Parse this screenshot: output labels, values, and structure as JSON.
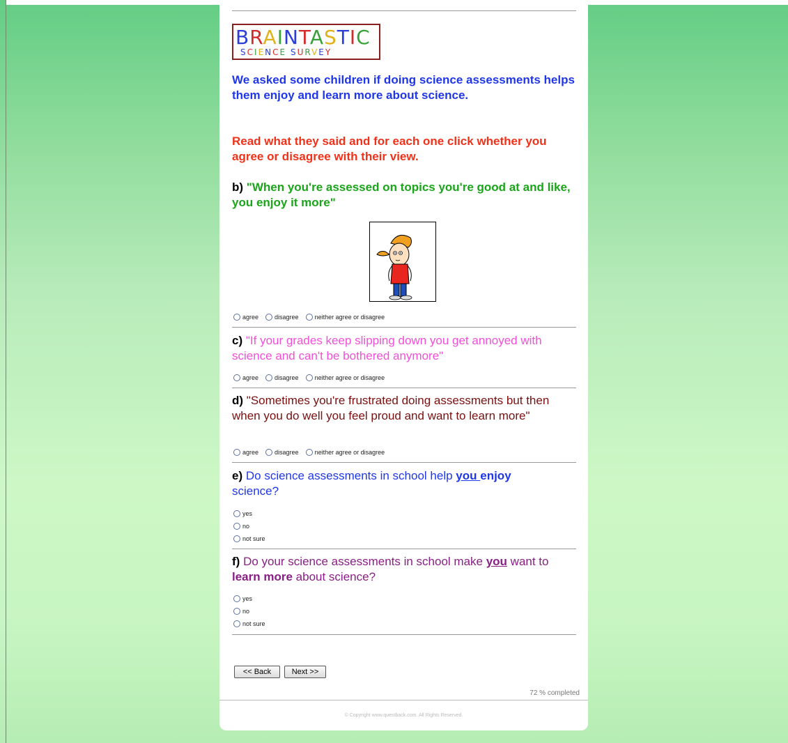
{
  "logo": {
    "line1": "BRAINTASTIC",
    "line2": "SCIENCE SURVEY",
    "line1_colors": [
      "#2b3fd8",
      "#d42a2a",
      "#e0b21a",
      "#3aa03a",
      "#2b3fd8",
      "#d42a2a",
      "#3aa03a",
      "#e0b21a",
      "#2b3fd8",
      "#d42a2a",
      "#3aa03a"
    ]
  },
  "intro": {
    "text1": "We asked some children if doing science assessments helps them enjoy and learn more about science.",
    "text2": "Read what they said and for each one click whether you agree or disagree with their view."
  },
  "colors": {
    "blue": "#1f37e8",
    "red": "#f0321a",
    "green": "#1aa51a",
    "pink": "#f24fd8",
    "maroon": "#7a1010",
    "purple": "#8a1e86"
  },
  "questions": {
    "b": {
      "label": "b)",
      "text": "\"When you're assessed on topics you're good at and like, you enjoy it more\""
    },
    "c": {
      "label": "c)",
      "text": "\"If your grades keep slipping down you get annoyed with science and can't be bothered anymore\""
    },
    "d": {
      "label": "d)",
      "text": "\"Sometimes you're frustrated doing assessments but then when you do well you feel proud and want to learn more\""
    },
    "e": {
      "label": "e)",
      "part1": "Do science assessments in school help ",
      "you": "you ",
      "enjoy": "enjoy",
      "part2": "science?"
    },
    "f": {
      "label": "f)",
      "part1": "Do your science assessments in school make ",
      "you": "you",
      "part2": " want to ",
      "learn_more": "learn more",
      "part3": " about science?"
    }
  },
  "agree_options": [
    "agree",
    "disagree",
    "neither agree or disagree"
  ],
  "yes_options": [
    "yes",
    "no",
    "not sure"
  ],
  "buttons": {
    "back": "<< Back",
    "next": "Next >>"
  },
  "progress": "72 % completed",
  "footer": {
    "prefix": "© Copyright ",
    "link": "www.questback.com",
    "suffix": ". All Rights Reserved."
  }
}
